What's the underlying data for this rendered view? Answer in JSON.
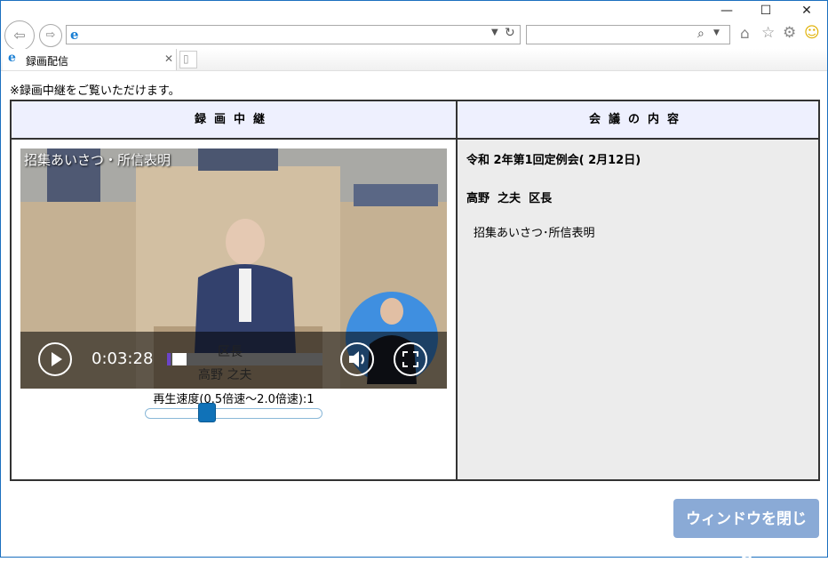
{
  "browser": {
    "tab_title": "録画配信",
    "window_controls": {
      "minimize": "—",
      "maximize": "☐",
      "close": "✕"
    }
  },
  "page": {
    "notice": "※録画中継をご覧いただけます。",
    "left_header": "録画中継",
    "right_header": "会議の内容",
    "meeting_title": "令和 2年第1回定例会( 2月12日)",
    "speaker": "高野  之夫  区長",
    "topic": "招集あいさつ･所信表明",
    "close_button": "ウィンドウを閉じる"
  },
  "video": {
    "caption": "招集あいさつ・所信表明",
    "current_time": "0:03:28",
    "progress_fraction": 0.02,
    "lectern_title": "区長",
    "lectern_name": "高野  之夫",
    "speed_label": "再生速度(0.5倍速〜2.0倍速):1",
    "speed_value": 1.0,
    "speed_min": 0.5,
    "speed_max": 2.0
  }
}
